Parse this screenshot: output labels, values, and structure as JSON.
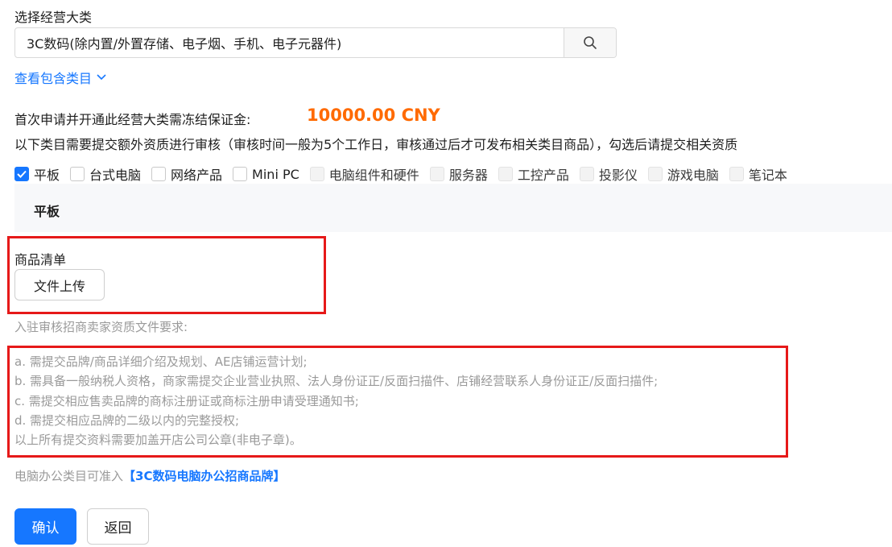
{
  "category_select": {
    "label": "选择经营大类",
    "value": "3C数码(除内置/外置存储、电子烟、手机、电子元器件)",
    "search_icon": "search-icon"
  },
  "view_included_link": "查看包含类目",
  "deposit": {
    "label": "首次申请并开通此经营大类需冻结保证金:",
    "amount": "10000.00 CNY",
    "color": "#ff6a00"
  },
  "extra_qual_note": "以下类目需要提交额外资质进行审核（审核时间一般为5个工作日，审核通过后才可发布相关类目商品），勾选后请提交相关资质",
  "categories": [
    {
      "label": "平板",
      "state": "checked"
    },
    {
      "label": "台式电脑",
      "state": "unchecked"
    },
    {
      "label": "网络产品",
      "state": "unchecked"
    },
    {
      "label": "Mini PC",
      "state": "unchecked"
    },
    {
      "label": "电脑组件和硬件",
      "state": "disabled"
    },
    {
      "label": "服务器",
      "state": "disabled"
    },
    {
      "label": "工控产品",
      "state": "disabled"
    },
    {
      "label": "投影仪",
      "state": "disabled"
    },
    {
      "label": "游戏电脑",
      "state": "disabled"
    },
    {
      "label": "笔记本",
      "state": "disabled"
    }
  ],
  "panel": {
    "title": "平板",
    "goods_list_label": "商品清单",
    "upload_button": "文件上传"
  },
  "requirements": {
    "title": "入驻审核招商卖家资质文件要求:",
    "items": [
      "a. 需提交品牌/商品详细介绍及规划、AE店铺运营计划;",
      "b. 需具备一般纳税人资格，商家需提交企业营业执照、法人身份证正/反面扫描件、店铺经营联系人身份证正/反面扫描件;",
      "c. 需提交相应售卖品牌的商标注册证或商标注册申请受理通知书;",
      "d. 需提交相应品牌的二级以内的完整授权;",
      "以上所有提交资料需要加盖开店公司公章(非电子章)。"
    ]
  },
  "access": {
    "prefix": "电脑办公类目可准入",
    "link": "【3C数码电脑办公招商品牌】"
  },
  "actions": {
    "confirm": "确认",
    "back": "返回"
  },
  "colors": {
    "accent": "#1677ff",
    "highlight_border": "#e61919"
  }
}
